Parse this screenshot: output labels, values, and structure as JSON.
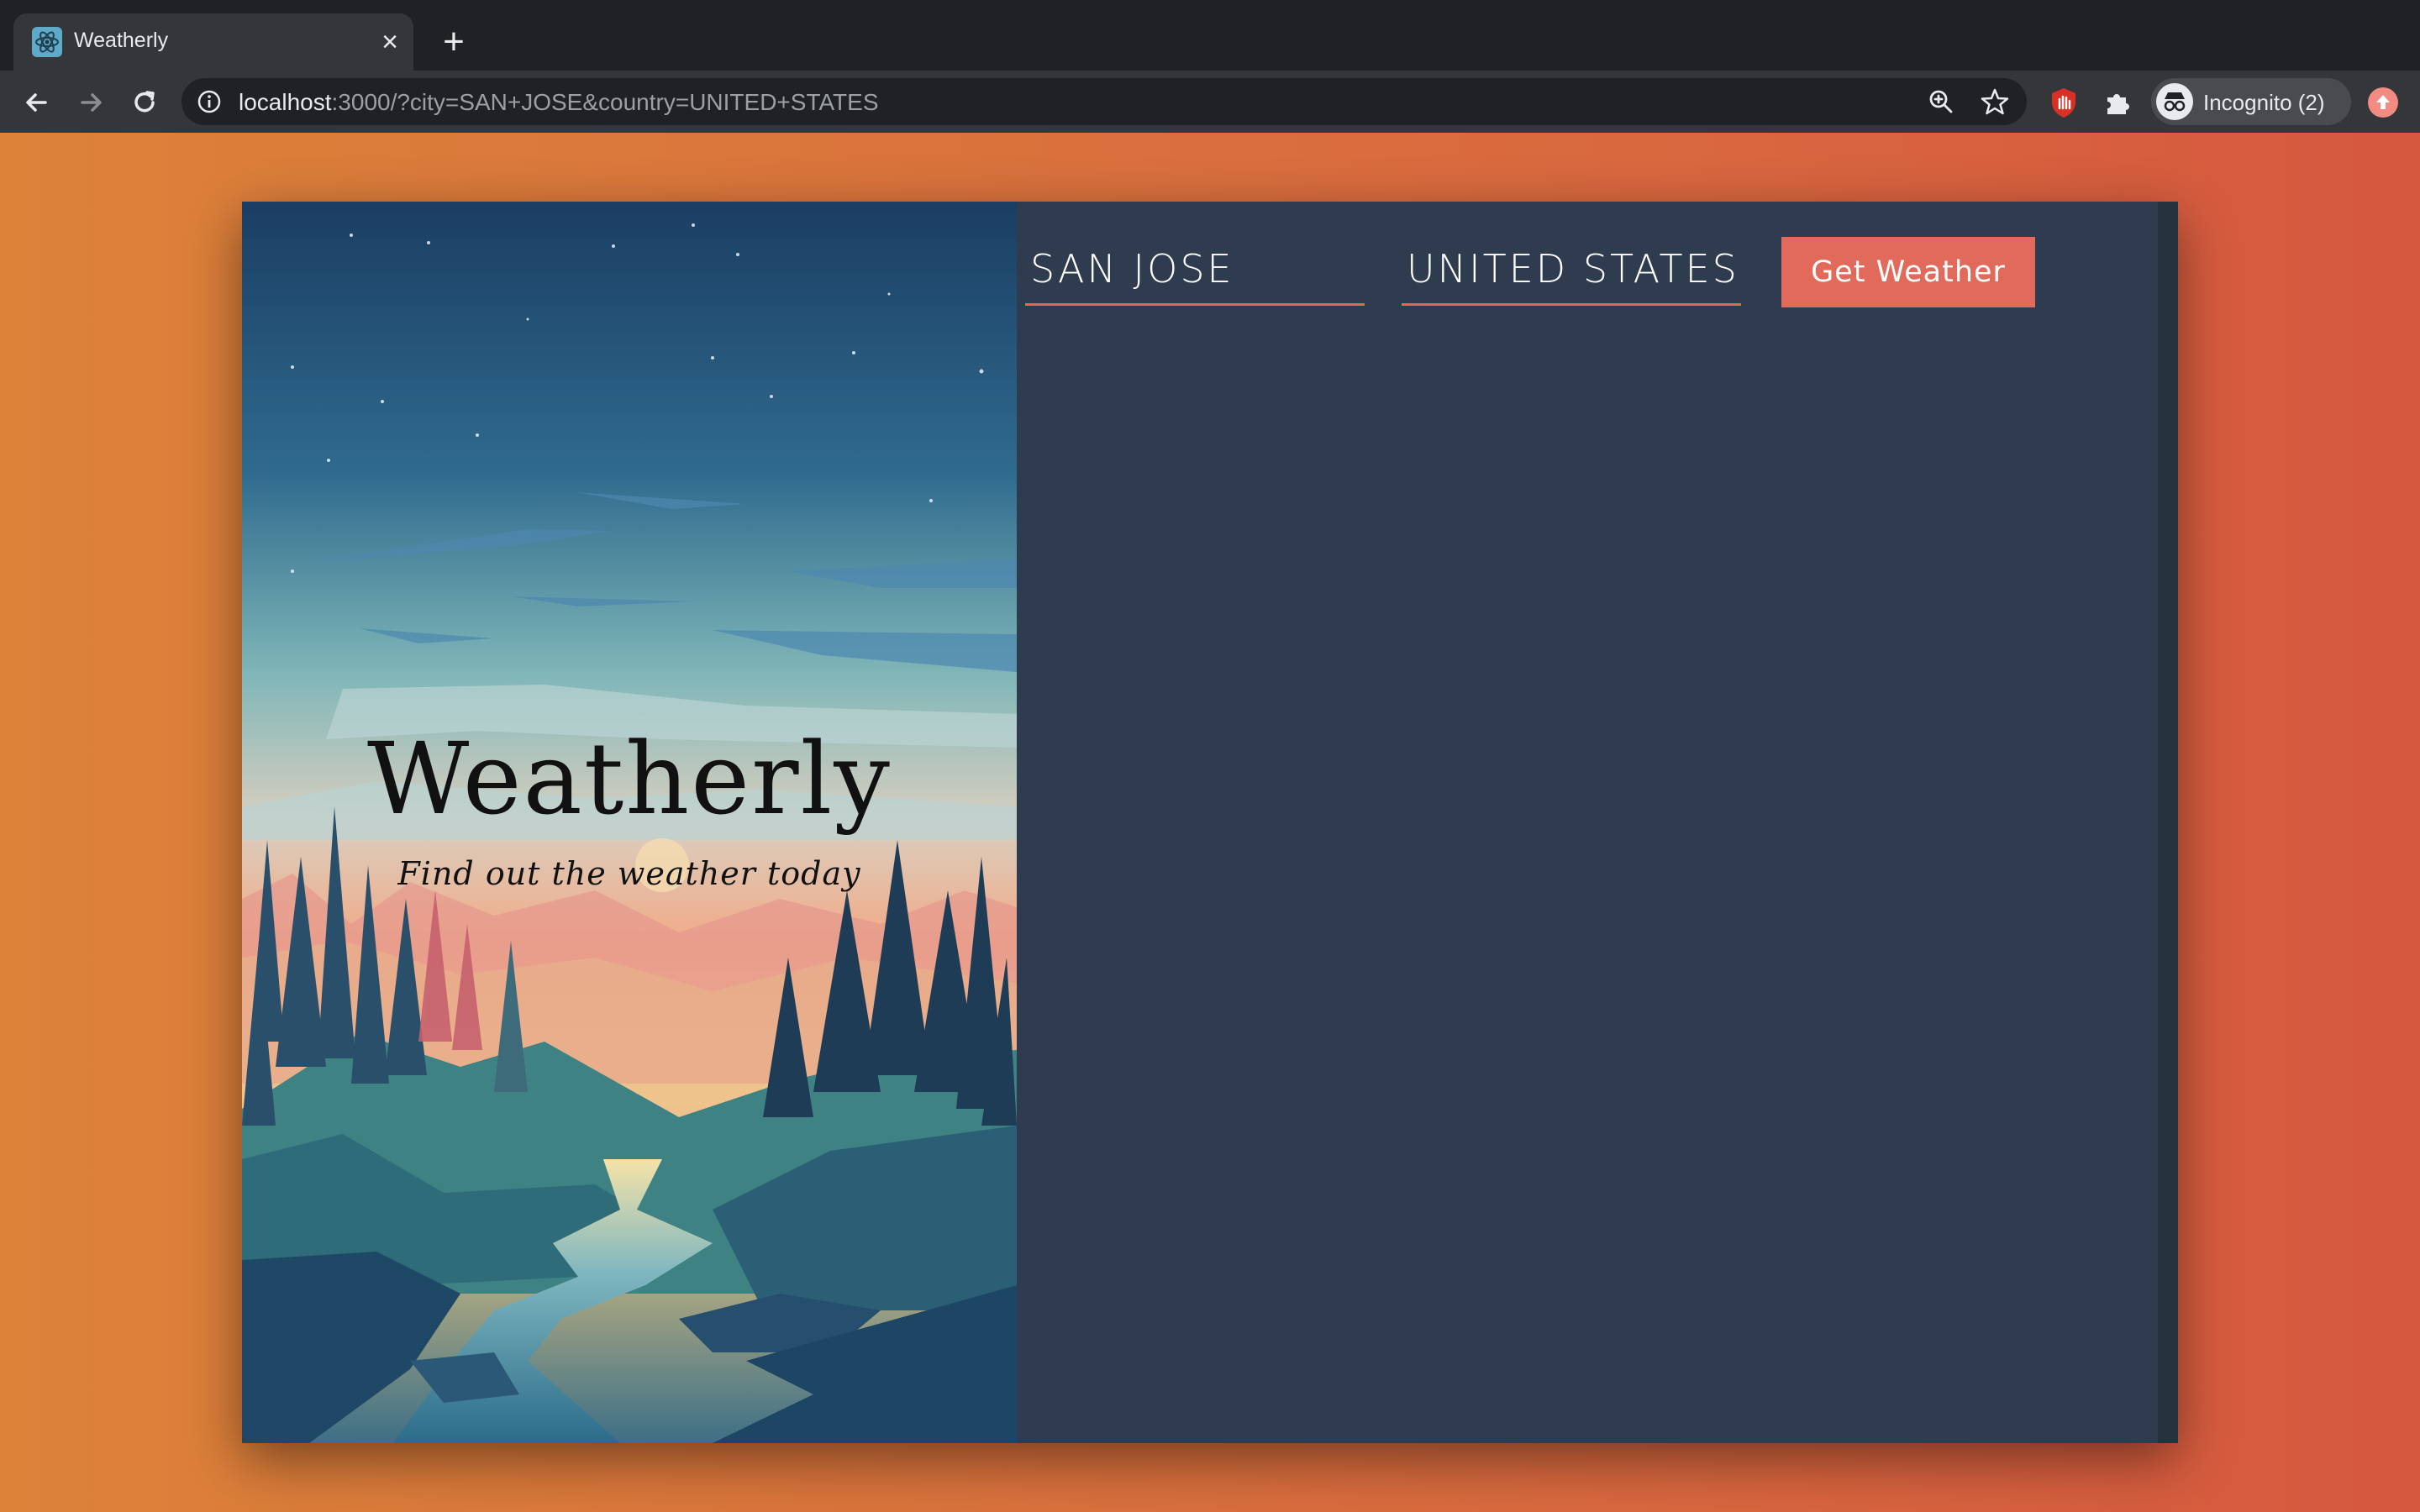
{
  "browser": {
    "tab": {
      "title": "Weatherly",
      "favicon": "react-atom-icon"
    },
    "address_bar": {
      "host": "localhost",
      "rest": ":3000/?city=SAN+JOSE&country=UNITED+STATES"
    },
    "profile": {
      "label": "Incognito (2)"
    },
    "icons": [
      "back-icon",
      "forward-icon",
      "reload-icon",
      "site-info-icon",
      "zoom-icon",
      "bookmark-star-icon",
      "extension-shield-icon",
      "extensions-puzzle-icon",
      "incognito-icon",
      "update-icon"
    ]
  },
  "app": {
    "title": "Weatherly",
    "subtitle": "Find out the weather today",
    "form": {
      "city_value": "SAN JOSE",
      "country_value": "UNITED STATES",
      "submit_label": "Get Weather"
    },
    "colors": {
      "accent": "#e16a5a",
      "panel": "#2f3c4f",
      "background_start": "#dc8239",
      "background_end": "#d6583f"
    }
  }
}
